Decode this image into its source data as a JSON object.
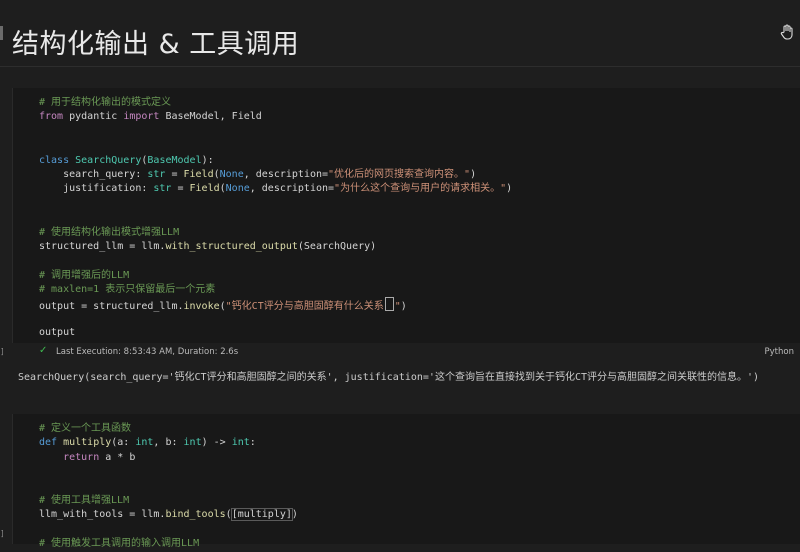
{
  "markdown": {
    "title": "结构化输出 & 工具调用"
  },
  "cell1": {
    "lines": [
      [
        [
          "cm",
          "# 用于结构化输出的模式定义"
        ]
      ],
      [
        [
          "kw2",
          "from"
        ],
        [
          "par",
          " pydantic "
        ],
        [
          "kw2",
          "import"
        ],
        [
          "par",
          " BaseModel, Field"
        ]
      ],
      [],
      [],
      [
        [
          "kw",
          "class"
        ],
        [
          "par",
          " "
        ],
        [
          "cls",
          "SearchQuery"
        ],
        [
          "par",
          "("
        ],
        [
          "cls",
          "BaseModel"
        ],
        [
          "par",
          "):"
        ]
      ],
      [
        [
          "par",
          "    search_query: "
        ],
        [
          "cls",
          "str"
        ],
        [
          "par",
          " = "
        ],
        [
          "fn",
          "Field"
        ],
        [
          "par",
          "("
        ],
        [
          "kw",
          "None"
        ],
        [
          "par",
          ", description="
        ],
        [
          "str",
          "\"优化后的网页搜索查询内容。\""
        ],
        [
          "par",
          ")"
        ]
      ],
      [
        [
          "par",
          "    justification: "
        ],
        [
          "cls",
          "str"
        ],
        [
          "par",
          " = "
        ],
        [
          "fn",
          "Field"
        ],
        [
          "par",
          "("
        ],
        [
          "kw",
          "None"
        ],
        [
          "par",
          ", description="
        ],
        [
          "str",
          "\"为什么这个查询与用户的请求相关。\""
        ],
        [
          "par",
          ")"
        ]
      ],
      [],
      [],
      [
        [
          "cm",
          "# 使用结构化输出模式增强LLM"
        ]
      ],
      [
        [
          "par",
          "structured_llm = llm."
        ],
        [
          "fn",
          "with_structured_output"
        ],
        [
          "par",
          "(SearchQuery)"
        ]
      ],
      [],
      [
        [
          "cm",
          "# 调用增强后的LLM"
        ]
      ],
      [
        [
          "cm",
          "# maxlen=1 表示只保留最后一个元素"
        ]
      ],
      [
        [
          "par",
          "output = structured_llm."
        ],
        [
          "fn",
          "invoke"
        ],
        [
          "par",
          "("
        ],
        [
          "str",
          "\"钙化CT评分与高胆固醇有什么关系"
        ],
        [
          "caret",
          ""
        ],
        [
          "str",
          "\""
        ],
        [
          "par",
          ")"
        ]
      ],
      [],
      [
        [
          "par",
          "output"
        ]
      ]
    ],
    "status": {
      "execution": "Last Execution: 8:53:43 AM, Duration: 2.6s",
      "language": "Python"
    },
    "output": "SearchQuery(search_query='钙化CT评分和高胆固醇之间的关系', justification='这个查询旨在直接找到关于钙化CT评分与高胆固醇之间关联性的信息。')"
  },
  "cell2": {
    "lines": [
      [
        [
          "cm",
          "# 定义一个工具函数"
        ]
      ],
      [
        [
          "kw",
          "def"
        ],
        [
          "par",
          " "
        ],
        [
          "fn",
          "multiply"
        ],
        [
          "par",
          "(a: "
        ],
        [
          "cls",
          "int"
        ],
        [
          "par",
          ", b: "
        ],
        [
          "cls",
          "int"
        ],
        [
          "par",
          ") -> "
        ],
        [
          "cls",
          "int"
        ],
        [
          "par",
          ":"
        ]
      ],
      [
        [
          "par",
          "    "
        ],
        [
          "kw2",
          "return"
        ],
        [
          "par",
          " a * b"
        ]
      ],
      [],
      [],
      [
        [
          "cm",
          "# 使用工具增强LLM"
        ]
      ],
      [
        [
          "par",
          "llm_with_tools = llm."
        ],
        [
          "fn",
          "bind_tools"
        ],
        [
          "par",
          "("
        ],
        [
          "brk",
          "[multiply]"
        ],
        [
          "par",
          ")"
        ]
      ],
      [],
      [
        [
          "cm",
          "# 使用触发工具调用的输入调用LLM"
        ]
      ]
    ]
  }
}
